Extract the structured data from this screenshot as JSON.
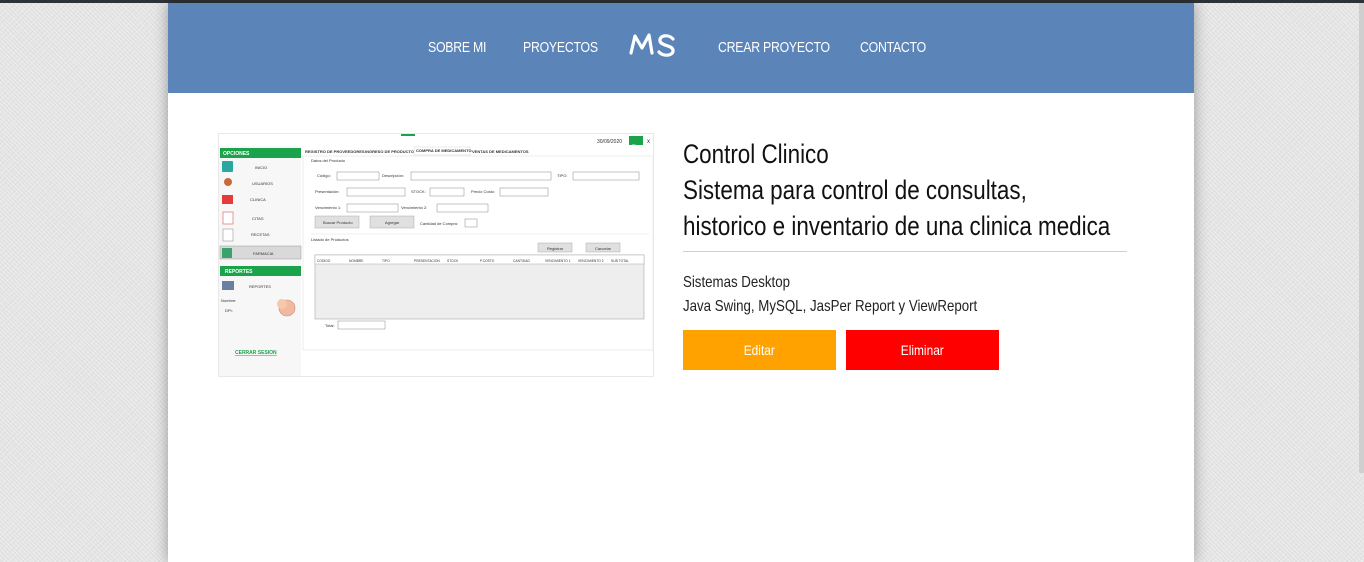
{
  "nav": {
    "items": [
      {
        "label": "SOBRE MI"
      },
      {
        "label": "PROYECTOS"
      },
      {
        "label": "CREAR PROYECTO"
      },
      {
        "label": "CONTACTO"
      }
    ],
    "logo_text": "MS"
  },
  "project": {
    "title_lines": [
      "Control Clinico",
      "Sistema para control de consultas,",
      "historico e inventario de una clinica medica"
    ],
    "category": "Sistemas Desktop",
    "technologies": "Java Swing, MySQL, JasPer Report y ViewReport",
    "edit_label": "Editar",
    "delete_label": "Eliminar"
  },
  "screenshot": {
    "date": "30/09/2020",
    "tabs": [
      "REGISTRO DE PROVEEDORES",
      "INGRESO DE PRODUCTOS",
      "COMPRA DE MEDICAMENTO",
      "VENTAS DE MEDICAMENTOS"
    ],
    "sidebar_header": "OPCIONES",
    "sidebar_items": [
      "INICIO",
      "USUARIOS",
      "CLINICA",
      "CITAS",
      "RECETAS",
      "FARMACIA"
    ],
    "reports_header": "REPORTES",
    "reports_item": "REPORTES",
    "user_labels": [
      "Nombre:",
      "DPI:"
    ],
    "logout": "CERRAR SESION",
    "section_product": "Datos del Producto",
    "fields": [
      "Código:",
      "Descripción:",
      "TIPO:",
      "Presentación:",
      "STOCK:",
      "Precio Costo:",
      "Vencimiento 1:",
      "Vencimiento 2:"
    ],
    "buttons": [
      "Buscar Producto",
      "Agregar",
      "Registrar",
      "Cancelar"
    ],
    "quantity_label": "Cantidad de Compra:",
    "section_list": "Listado de Productos",
    "columns": [
      "CODIGO",
      "NOMBRE",
      "TIPO",
      "PRESENTACION",
      "STOCK",
      "P.COSTO",
      "CANTIDAD",
      "VENCIMIENTO 1",
      "VENCIMIENTO 2",
      "SUB TOTAL"
    ],
    "total_label": "Total:"
  },
  "colors": {
    "navbar": "#5b84b8",
    "edit": "#ffa200",
    "delete": "#ff0000",
    "app_green": "#1aa34a"
  }
}
